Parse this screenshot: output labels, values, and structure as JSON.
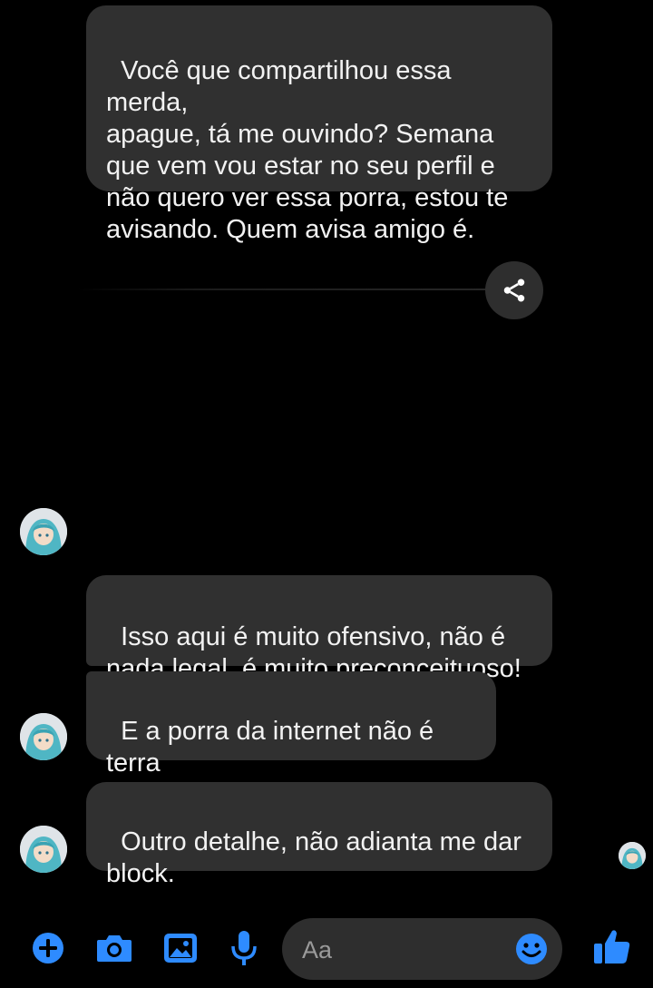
{
  "messages": [
    {
      "id": "msg1",
      "sender": "other",
      "text": "Você que compartilhou essa merda,\napague, tá me ouvindo? Semana\nque vem vou estar no seu perfil e\nnão quero ver essa porra, estou te\navisando. Quem avisa amigo é."
    },
    {
      "id": "msg2",
      "sender": "other",
      "text": "Isso aqui é muito ofensivo, não é\nnada legal, é muito preconceituoso!"
    },
    {
      "id": "msg3",
      "sender": "other",
      "text": "E a porra da internet não é terra\nsem lei."
    },
    {
      "id": "msg4",
      "sender": "other",
      "text": "Outro detalhe, não adianta me dar\nblock."
    }
  ],
  "composer": {
    "placeholder": "Aa",
    "icons": [
      "plus-circle-icon",
      "camera-icon",
      "image-icon",
      "microphone-icon",
      "emoji-icon",
      "thumbs-up-icon"
    ]
  },
  "colors": {
    "background": "#000000",
    "bubble": "#303030",
    "accent": "#2e8bff",
    "text": "#f2f2f2"
  }
}
